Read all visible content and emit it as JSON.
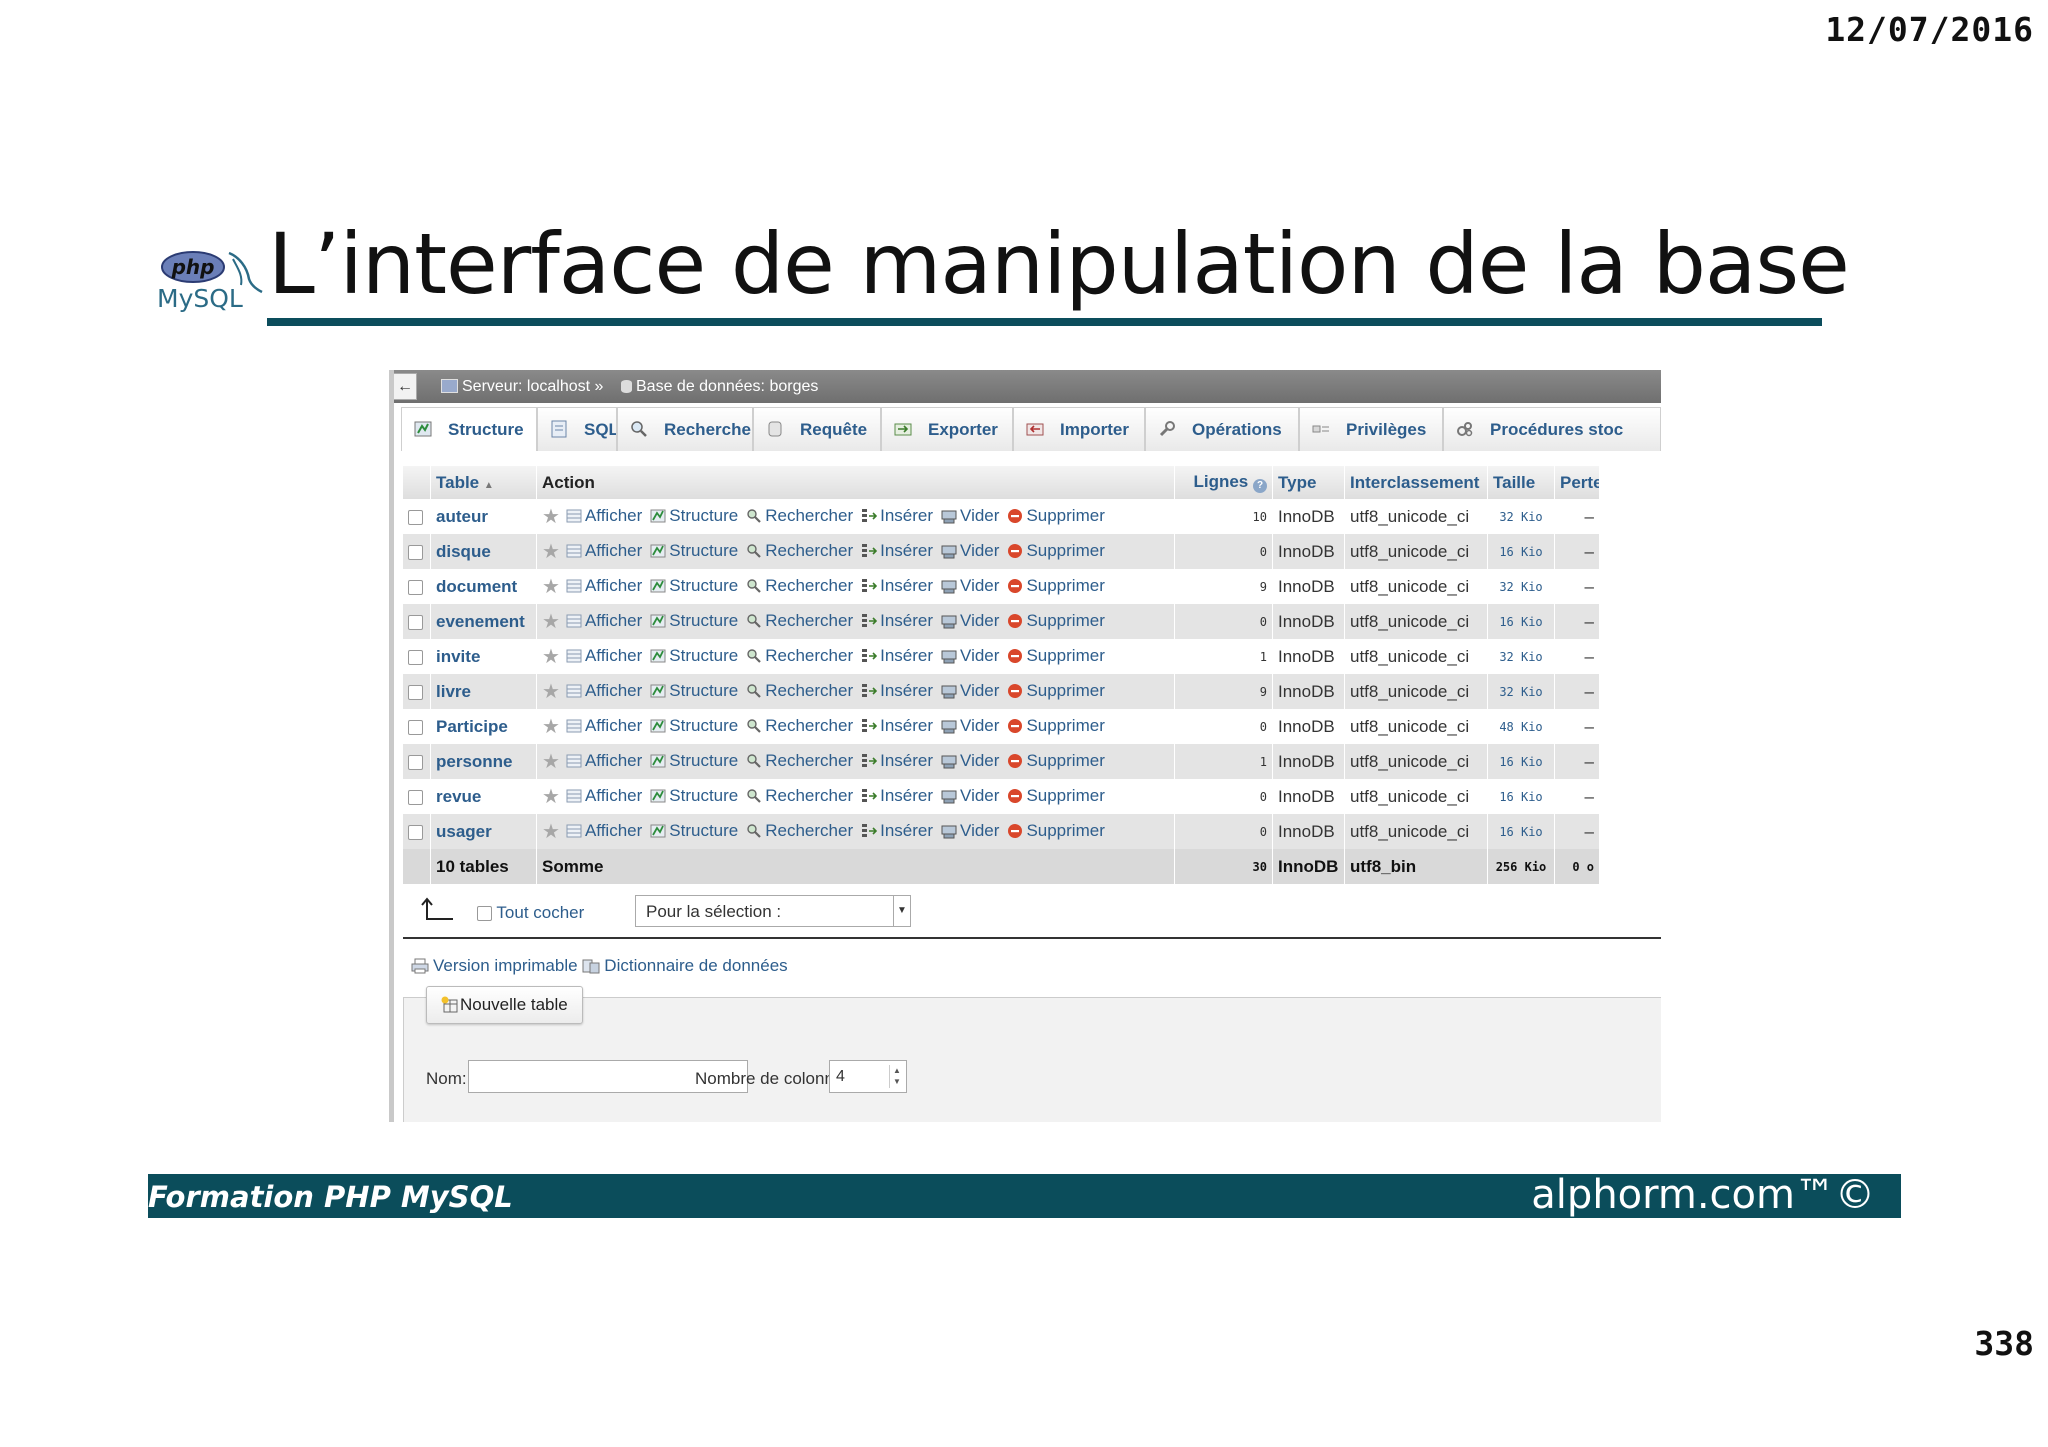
{
  "slide": {
    "date": "12/07/2016",
    "title": "L’interface de manipulation de la base",
    "logo_php": "php",
    "logo_mysql": "MySQL",
    "footer_left": "Formation PHP MySQL",
    "footer_right": "alphorm.com™©",
    "page_number": "338"
  },
  "pma": {
    "back_label": "←",
    "breadcrumb": {
      "server": "Serveur: localhost »",
      "database": "Base de données: borges"
    },
    "tabs": [
      {
        "label": "Structure",
        "icon": "structure-icon"
      },
      {
        "label": "SQL",
        "icon": "sql-icon"
      },
      {
        "label": "Rechercher",
        "icon": "search-icon"
      },
      {
        "label": "Requête",
        "icon": "query-icon"
      },
      {
        "label": "Exporter",
        "icon": "export-icon"
      },
      {
        "label": "Importer",
        "icon": "import-icon"
      },
      {
        "label": "Opérations",
        "icon": "wrench-icon"
      },
      {
        "label": "Privilèges",
        "icon": "privileges-icon"
      },
      {
        "label": "Procédures stoc",
        "icon": "routines-icon"
      }
    ],
    "table_headers": {
      "table": "Table",
      "action": "Action",
      "rows": "Lignes",
      "type": "Type",
      "collation": "Interclassement",
      "size": "Taille",
      "overhead": "Perte"
    },
    "actions": {
      "browse": "Afficher",
      "structure": "Structure",
      "search": "Rechercher",
      "insert": "Insérer",
      "empty": "Vider",
      "drop": "Supprimer"
    },
    "tables": [
      {
        "name": "auteur",
        "rows": "10",
        "type": "InnoDB",
        "collation": "utf8_unicode_ci",
        "size": "32 Kio",
        "overhead": "–"
      },
      {
        "name": "disque",
        "rows": "0",
        "type": "InnoDB",
        "collation": "utf8_unicode_ci",
        "size": "16 Kio",
        "overhead": "–"
      },
      {
        "name": "document",
        "rows": "9",
        "type": "InnoDB",
        "collation": "utf8_unicode_ci",
        "size": "32 Kio",
        "overhead": "–"
      },
      {
        "name": "evenement",
        "rows": "0",
        "type": "InnoDB",
        "collation": "utf8_unicode_ci",
        "size": "16 Kio",
        "overhead": "–"
      },
      {
        "name": "invite",
        "rows": "1",
        "type": "InnoDB",
        "collation": "utf8_unicode_ci",
        "size": "32 Kio",
        "overhead": "–"
      },
      {
        "name": "livre",
        "rows": "9",
        "type": "InnoDB",
        "collation": "utf8_unicode_ci",
        "size": "32 Kio",
        "overhead": "–"
      },
      {
        "name": "Participe",
        "rows": "0",
        "type": "InnoDB",
        "collation": "utf8_unicode_ci",
        "size": "48 Kio",
        "overhead": "–"
      },
      {
        "name": "personne",
        "rows": "1",
        "type": "InnoDB",
        "collation": "utf8_unicode_ci",
        "size": "16 Kio",
        "overhead": "–"
      },
      {
        "name": "revue",
        "rows": "0",
        "type": "InnoDB",
        "collation": "utf8_unicode_ci",
        "size": "16 Kio",
        "overhead": "–"
      },
      {
        "name": "usager",
        "rows": "0",
        "type": "InnoDB",
        "collation": "utf8_unicode_ci",
        "size": "16 Kio",
        "overhead": "–"
      }
    ],
    "summary": {
      "count": "10 tables",
      "label": "Somme",
      "rows": "30",
      "type": "InnoDB",
      "collation": "utf8_bin",
      "size": "256 Kio",
      "overhead": "0 o"
    },
    "check_all": "Tout cocher",
    "with_selected": "Pour la sélection :",
    "print_view": "Version imprimable",
    "data_dictionary": "Dictionnaire de données",
    "new_table": {
      "legend": "Nouvelle table",
      "name_label": "Nom:",
      "name_value": "",
      "columns_label": "Nombre de colonnes:",
      "columns_value": "4"
    },
    "colors": {
      "link": "#2d5d8c",
      "topbar": "#7a7a7a",
      "drop_red": "#d9472b",
      "footer_band": "#0b4d5b"
    }
  }
}
